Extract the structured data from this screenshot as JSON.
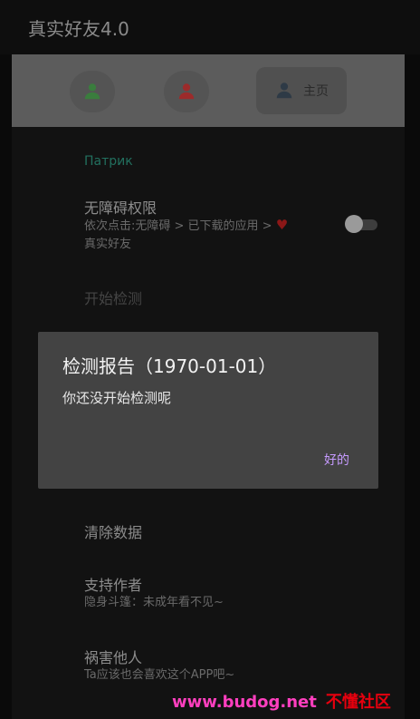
{
  "app": {
    "title": "真实好友4.0"
  },
  "nav": {
    "items": [
      {
        "icon": "person-icon",
        "color": "#3a7d3d"
      },
      {
        "icon": "person-icon",
        "color": "#9c2b2b"
      },
      {
        "icon": "person-icon",
        "color": "#2e3a46",
        "label": "主页"
      }
    ]
  },
  "settings": {
    "section_header": "Патрик",
    "accessibility": {
      "title": "无障碍权限",
      "subtitle_line1": "依次点击:无障碍 > 已下载的应用 >",
      "subtitle_heart": "♥",
      "subtitle_line2": "真实好友",
      "switch_on": false
    },
    "start_detect": {
      "title": "开始检测"
    },
    "clear_data": {
      "title": "清除数据"
    },
    "support_author": {
      "title": "支持作者",
      "subtitle": "隐身斗篷：未成年看不见~"
    },
    "harm_others": {
      "title": "祸害他人",
      "subtitle": "Ta应该也会喜欢这个APP吧~"
    }
  },
  "dialog": {
    "title": "检测报告（1970-01-01）",
    "message": "你还没开始检测呢",
    "ok_label": "好的"
  },
  "watermark": {
    "url": "www.budog.net",
    "name": "不懂社区"
  },
  "colors": {
    "accent_section": "#22705f",
    "dialog_button": "#c69bff",
    "heart": "#8b1717"
  }
}
